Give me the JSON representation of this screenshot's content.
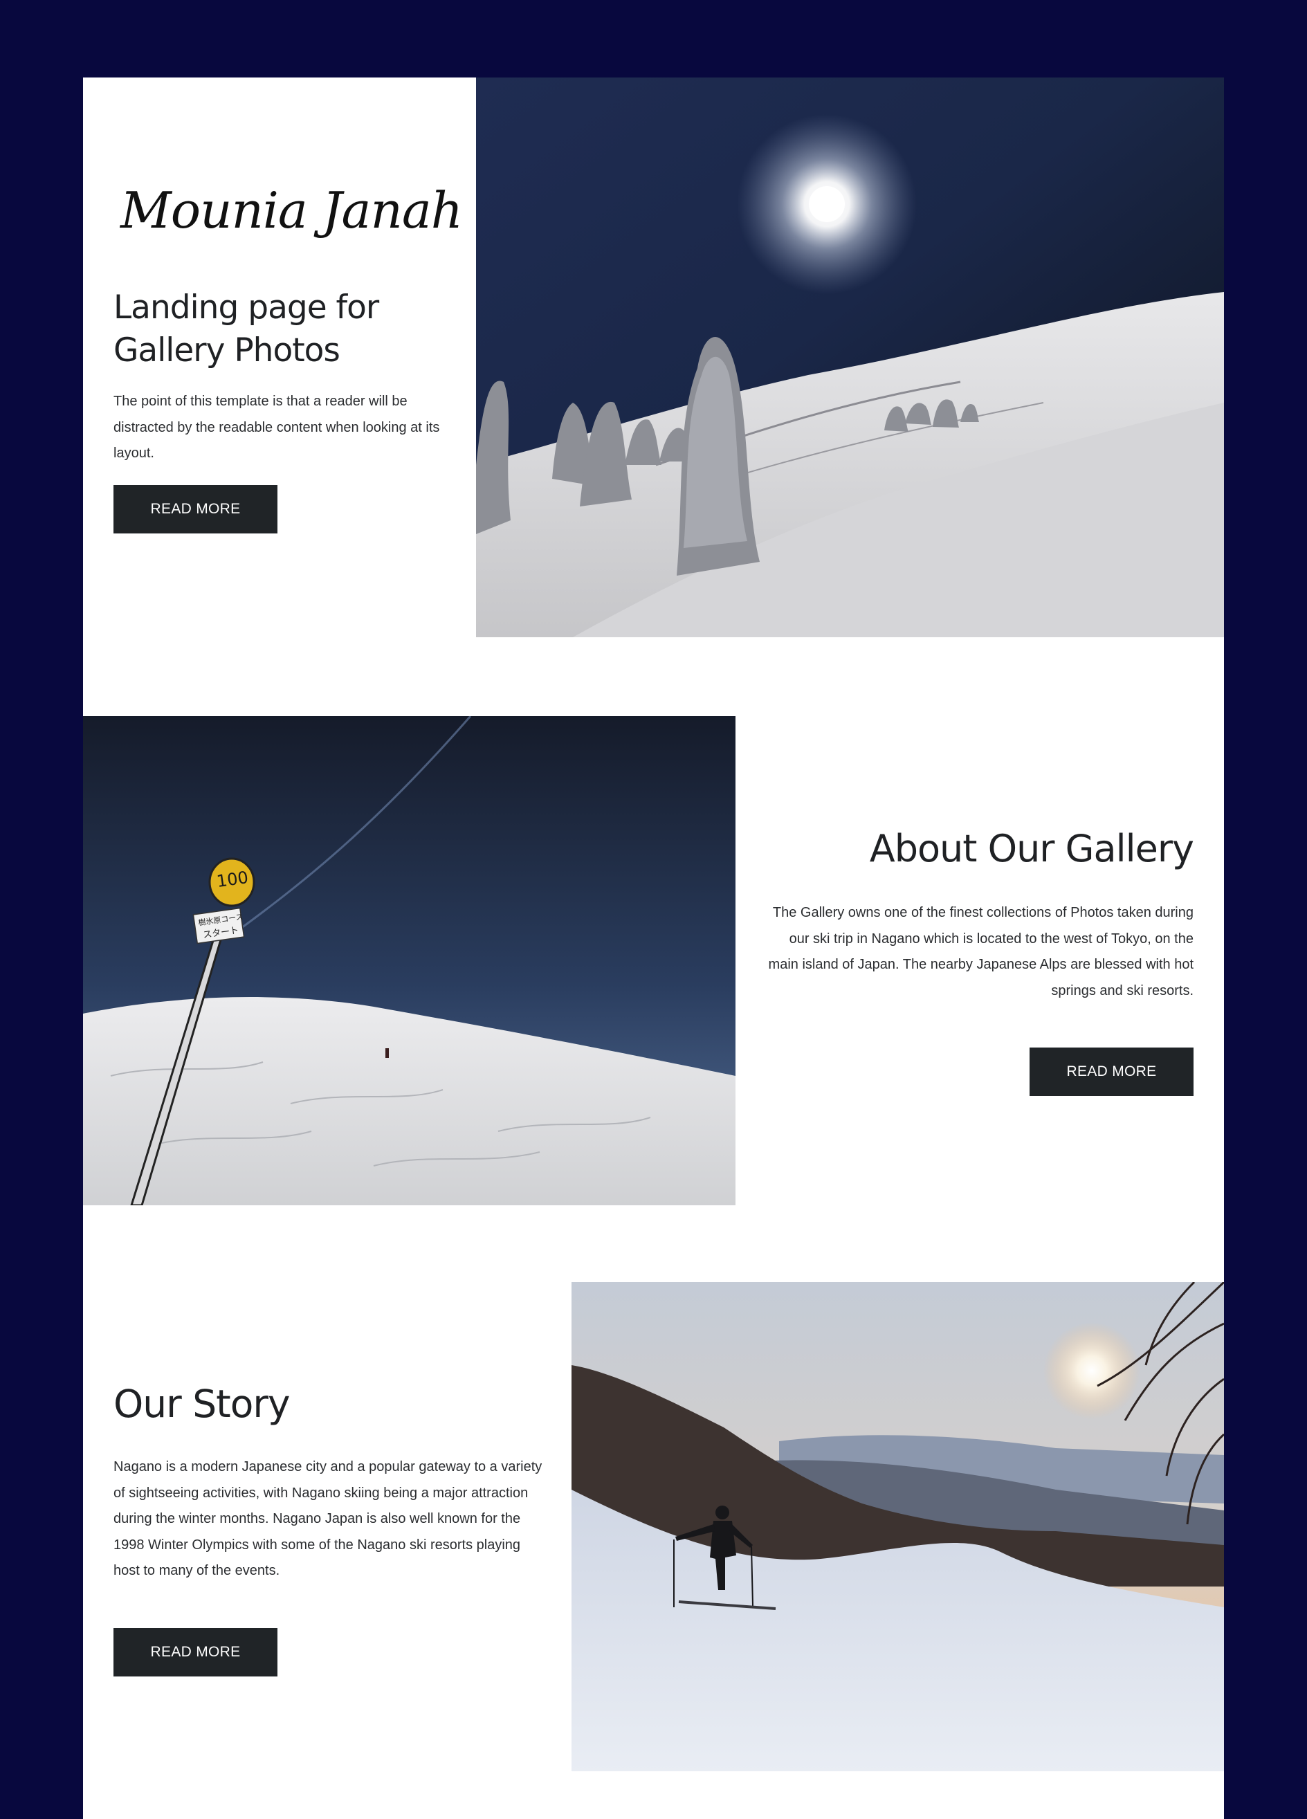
{
  "brand": {
    "logo_text": "Mounia Janah"
  },
  "hero": {
    "title": "Landing page for Gallery Photos",
    "text": "The point of this template is that a reader will be distracted by the readable content when looking at its layout.",
    "button_label": "READ MORE"
  },
  "about": {
    "title": "About Our Gallery",
    "text": "The Gallery owns one of the finest collections of Photos taken during our ski trip in Nagano which is located to the west of Tokyo, on the main island of Japan. The nearby Japanese Alps are blessed with hot springs and ski resorts.",
    "button_label": "READ MORE"
  },
  "story": {
    "title": "Our Story",
    "text": "Nagano is a modern Japanese city and a popular gateway to a variety of sightseeing activities, with Nagano skiing being a major attraction during the winter months. Nagano Japan is also well known for the 1998 Winter Olympics with some of the Nagano ski resorts playing host to many of the events.",
    "button_label": "READ MORE"
  },
  "sign": {
    "number": "100",
    "line1": "樹氷原コース",
    "line2": "スタート"
  },
  "colors": {
    "page_background": "#08083e",
    "content_background": "#ffffff",
    "button_background": "#202427",
    "button_text": "#ffffff",
    "heading_text": "#1f2124"
  }
}
